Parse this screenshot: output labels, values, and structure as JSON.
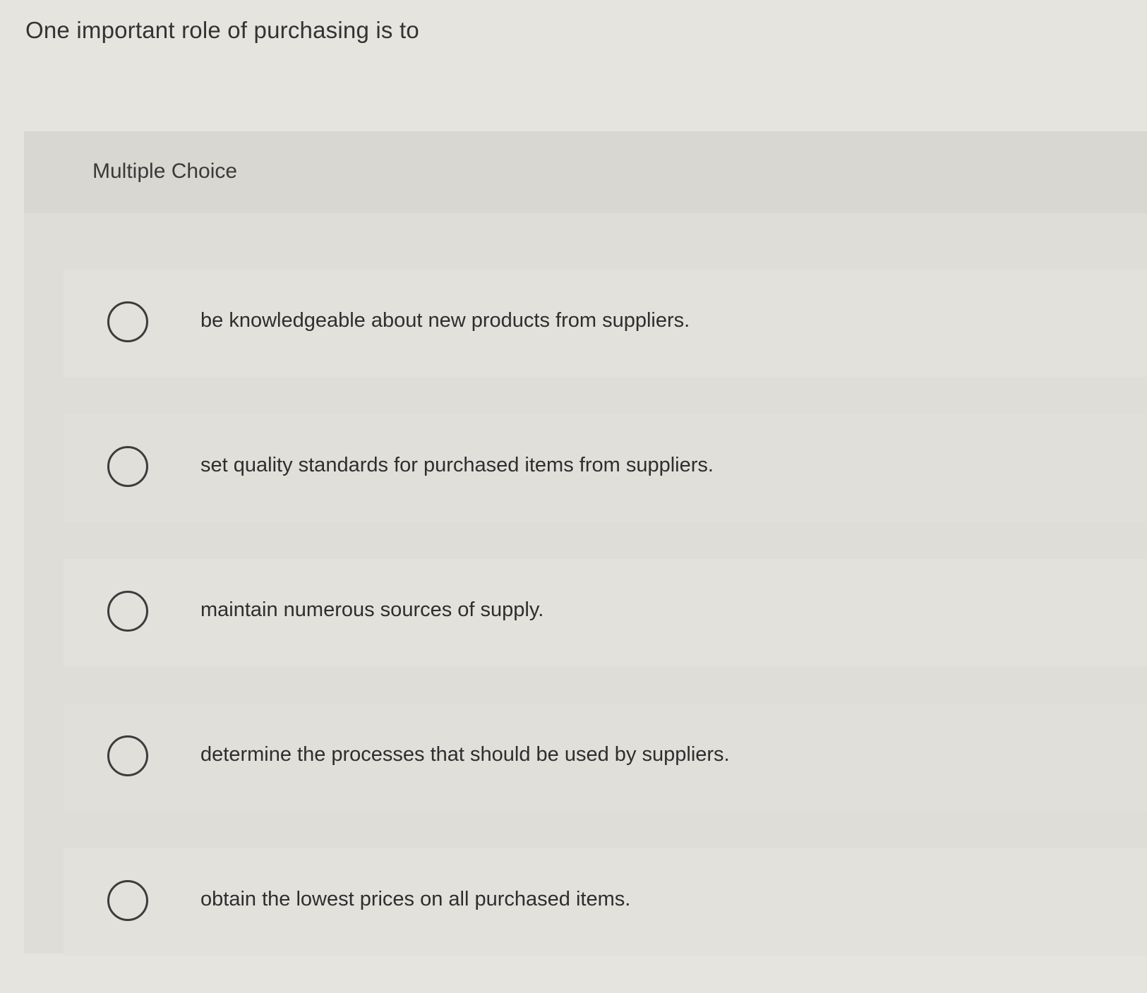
{
  "question": {
    "prompt": "One important role of purchasing is to"
  },
  "panel": {
    "label": "Multiple Choice"
  },
  "choices": [
    {
      "label": "be knowledgeable about new products from suppliers.",
      "selected": false
    },
    {
      "label": "set quality standards for purchased items from suppliers.",
      "selected": false
    },
    {
      "label": "maintain numerous sources of supply.",
      "selected": false
    },
    {
      "label": "determine the processes that should be used by suppliers.",
      "selected": false
    },
    {
      "label": "obtain the lowest prices on all purchased items.",
      "selected": false
    }
  ]
}
